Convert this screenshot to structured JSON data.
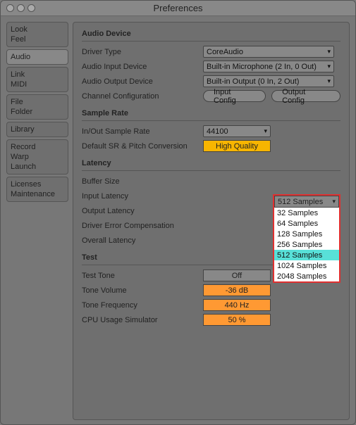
{
  "window": {
    "title": "Preferences"
  },
  "sidebar": {
    "groups": [
      {
        "items": [
          "Look",
          "Feel"
        ],
        "active": false
      },
      {
        "items": [
          "Audio"
        ],
        "active": true
      },
      {
        "items": [
          "Link",
          "MIDI"
        ],
        "active": false
      },
      {
        "items": [
          "File",
          "Folder"
        ],
        "active": false
      },
      {
        "items": [
          "Library"
        ],
        "active": false
      },
      {
        "items": [
          "Record",
          "Warp",
          "Launch"
        ],
        "active": false
      },
      {
        "items": [
          "Licenses",
          "Maintenance"
        ],
        "active": false
      }
    ]
  },
  "sections": {
    "audio_device": {
      "title": "Audio Device",
      "driver_type_label": "Driver Type",
      "driver_type_value": "CoreAudio",
      "audio_input_label": "Audio Input Device",
      "audio_input_value": "Built-in Microphone (2 In, 0 Out)",
      "audio_output_label": "Audio Output Device",
      "audio_output_value": "Built-in Output (0 In, 2 Out)",
      "channel_config_label": "Channel Configuration",
      "input_config_btn": "Input Config",
      "output_config_btn": "Output Config"
    },
    "sample_rate": {
      "title": "Sample Rate",
      "inout_label": "In/Out Sample Rate",
      "inout_value": "44100",
      "default_sr_label": "Default SR & Pitch Conversion",
      "default_sr_value": "High Quality"
    },
    "latency": {
      "title": "Latency",
      "buffer_size_label": "Buffer Size",
      "buffer_size_value": "512 Samples",
      "buffer_size_options": [
        "32 Samples",
        "64 Samples",
        "128 Samples",
        "256 Samples",
        "512 Samples",
        "1024 Samples",
        "2048 Samples"
      ],
      "buffer_size_highlight": "512 Samples",
      "input_latency_label": "Input Latency",
      "output_latency_label": "Output Latency",
      "driver_error_label": "Driver Error Compensation",
      "overall_latency_label": "Overall Latency"
    },
    "test": {
      "title": "Test",
      "test_tone_label": "Test Tone",
      "test_tone_value": "Off",
      "tone_volume_label": "Tone Volume",
      "tone_volume_value": "-36 dB",
      "tone_freq_label": "Tone Frequency",
      "tone_freq_value": "440 Hz",
      "cpu_label": "CPU Usage Simulator",
      "cpu_value": "50 %"
    }
  }
}
